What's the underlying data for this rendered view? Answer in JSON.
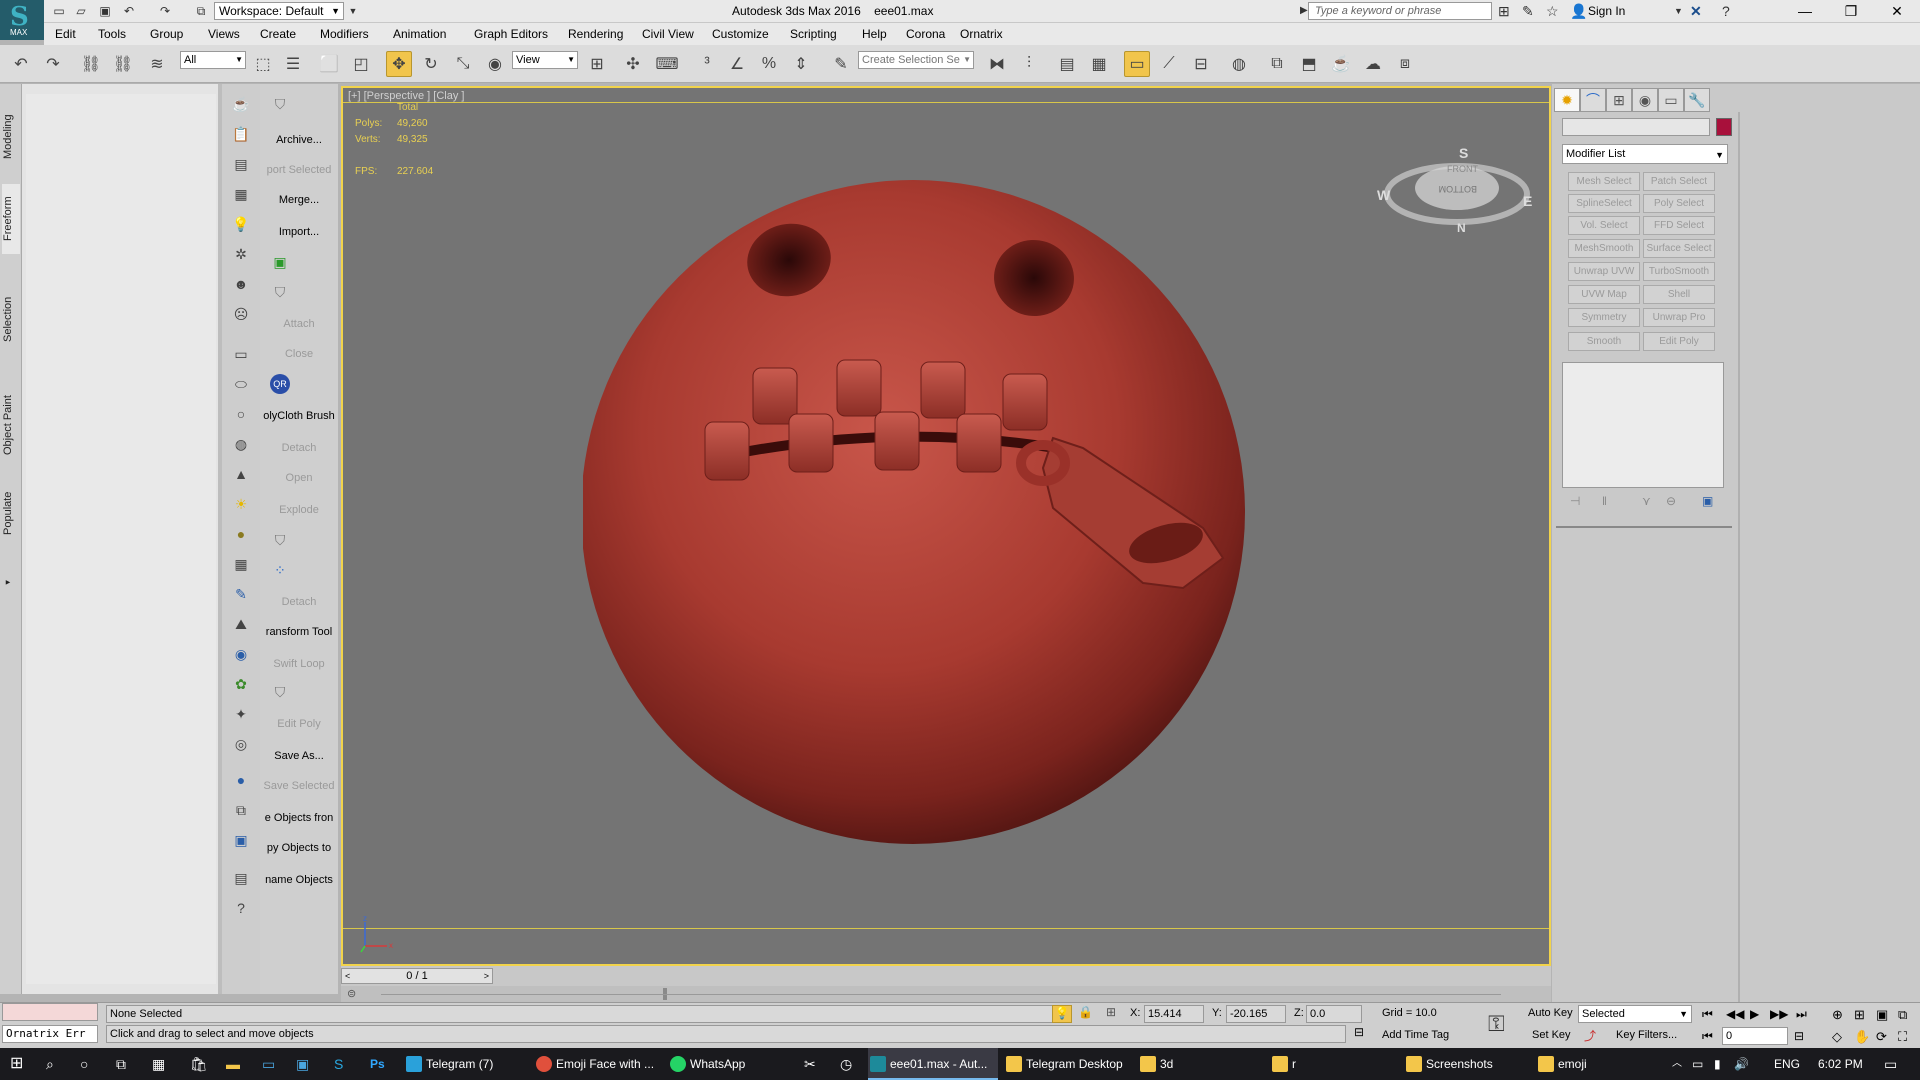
{
  "app": {
    "logo_label": "MAX",
    "title": "Autodesk 3ds Max 2016",
    "filename": "eee01.max",
    "workspace": "Workspace: Default",
    "search_placeholder": "Type a keyword or phrase",
    "sign_in": "Sign In"
  },
  "menu": [
    "Edit",
    "Tools",
    "Group",
    "Views",
    "Create",
    "Modifiers",
    "Animation",
    "Graph Editors",
    "Rendering",
    "Civil View",
    "Customize",
    "Scripting",
    "Help",
    "Corona",
    "Ornatrix"
  ],
  "toolbar": {
    "selection_filter": "All",
    "ref_coord": "View",
    "selection_set_placeholder": "Create Selection Se"
  },
  "ribbon_tabs": [
    "Modeling",
    "Freeform",
    "Selection",
    "Object Paint",
    "Populate"
  ],
  "commands": [
    {
      "label": "Archive...",
      "enabled": true
    },
    {
      "label": "port Selected",
      "enabled": false
    },
    {
      "label": "Merge...",
      "enabled": true
    },
    {
      "label": "Import...",
      "enabled": true
    },
    {
      "label": "Attach",
      "enabled": false
    },
    {
      "label": "Close",
      "enabled": false
    },
    {
      "label": "olyCloth Brush",
      "enabled": true
    },
    {
      "label": "Detach",
      "enabled": false
    },
    {
      "label": "Open",
      "enabled": false
    },
    {
      "label": "Explode",
      "enabled": false
    },
    {
      "label": "Detach",
      "enabled": false
    },
    {
      "label": "ransform Tool",
      "enabled": true
    },
    {
      "label": "Swift Loop",
      "enabled": false
    },
    {
      "label": "Edit Poly",
      "enabled": false
    },
    {
      "label": "Save As...",
      "enabled": true
    },
    {
      "label": "Save Selected",
      "enabled": false
    },
    {
      "label": "e Objects fron",
      "enabled": true
    },
    {
      "label": "py Objects to",
      "enabled": true
    },
    {
      "label": "name Objects",
      "enabled": true
    }
  ],
  "viewport": {
    "label": "[+] [Perspective ] [Clay ]",
    "stats_header": "Total",
    "polys_label": "Polys:",
    "polys_value": "49,260",
    "verts_label": "Verts:",
    "verts_value": "49,325",
    "fps_label": "FPS:",
    "fps_value": "227.604",
    "viewcube_front": "FRONT",
    "viewcube_bottom": "BOTTOM",
    "compass": {
      "n": "N",
      "s": "S",
      "e": "E",
      "w": "W"
    },
    "axis": {
      "x": "x",
      "z": "z"
    }
  },
  "timeline": {
    "counter": "0 / 1"
  },
  "modifiers": {
    "list_label": "Modifier List",
    "buttons": [
      "Mesh Select",
      "Patch Select",
      "SplineSelect",
      "Poly Select",
      "Vol. Select",
      "FFD Select",
      "MeshSmooth",
      "Surface Select",
      "Unwrap UVW",
      "TurboSmooth",
      "UVW Map",
      "Shell",
      "Symmetry",
      "Unwrap Pro",
      "Smooth",
      "Edit Poly"
    ]
  },
  "status": {
    "script_field": "Ornatrix Err",
    "selection_status": "None Selected",
    "prompt": "Click and drag to select and move objects",
    "x_label": "X:",
    "x_value": "15.414",
    "y_label": "Y:",
    "y_value": "-20.165",
    "z_label": "Z:",
    "z_value": "0.0",
    "grid": "Grid = 10.0",
    "add_time_tag": "Add Time Tag",
    "auto_key": "Auto Key",
    "set_key": "Set Key",
    "key_mode": "Selected",
    "key_filters": "Key Filters...",
    "frame": "0"
  },
  "taskbar": {
    "tasks": [
      {
        "label": "Telegram (7)",
        "color": "#2aa1da",
        "active": false
      },
      {
        "label": "Emoji Face with ...",
        "color": "#e0503c",
        "active": false
      },
      {
        "label": "WhatsApp",
        "color": "#25d366",
        "active": false
      },
      {
        "label": "eee01.max - Aut...",
        "color": "#1d8a9a",
        "active": true
      },
      {
        "label": "Telegram Desktop",
        "color": "#f3c64a",
        "active": false
      },
      {
        "label": "3d",
        "color": "#f3c64a",
        "active": false
      },
      {
        "label": "r",
        "color": "#f3c64a",
        "active": false
      },
      {
        "label": "Screenshots",
        "color": "#f3c64a",
        "active": false
      },
      {
        "label": "emoji",
        "color": "#f3c64a",
        "active": false
      }
    ],
    "lang": "ENG",
    "time": "6:02 PM"
  }
}
